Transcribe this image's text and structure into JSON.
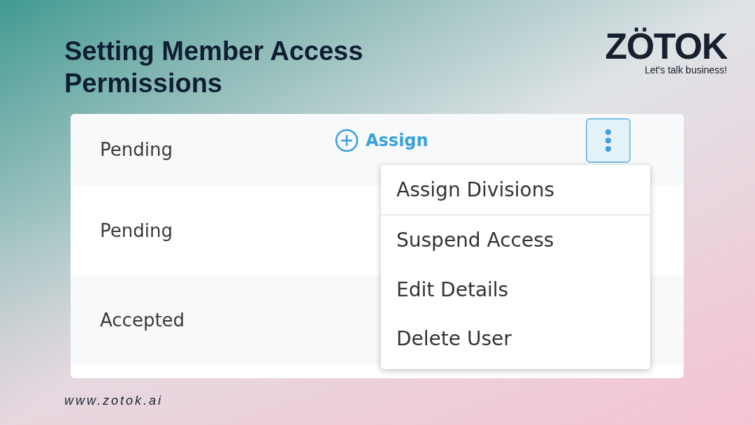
{
  "title": "Setting Member Access Permissions",
  "logo": {
    "name": "ZÖTOK",
    "tagline": "Let's talk business!"
  },
  "rows": [
    {
      "status": "Pending",
      "assign": "Assign"
    },
    {
      "status": "Pending"
    },
    {
      "status": "Accepted"
    }
  ],
  "menu": {
    "expanded": true,
    "items": [
      "Assign Divisions",
      "Suspend Access",
      "Edit Details",
      "Delete User"
    ]
  },
  "footer": "www.zotok.ai"
}
